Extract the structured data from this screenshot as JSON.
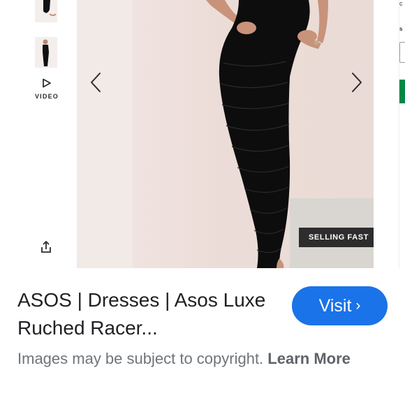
{
  "thumbnails": {
    "video_label": "VIDEO",
    "video_icon": "play-triangle",
    "share_icon": "share-upload"
  },
  "gallery": {
    "badge": "SELLING FAST",
    "prev_icon": "chevron-left",
    "next_icon": "chevron-right",
    "colors": {
      "background": "#eddcd8",
      "dress": "#0d0d0d",
      "skin": "#c8937a"
    }
  },
  "result": {
    "title": "ASOS | Dresses | Asos Luxe Ruched Racer...",
    "visit_label": "Visit",
    "visit_chevron": "›",
    "visit_color": "#1a73e8",
    "copyright_text": "Images may be subject to copyright.",
    "learn_more": "Learn More"
  },
  "side_panel": {
    "letter_top": "c",
    "letter_size": "s",
    "add_button_color": "#018849"
  }
}
